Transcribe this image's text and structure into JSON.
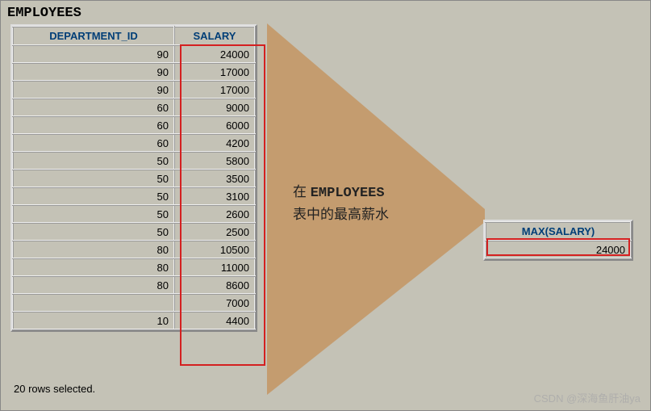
{
  "title": "EMPLOYEES",
  "columns": {
    "dept": "DEPARTMENT_ID",
    "salary": "SALARY"
  },
  "rows": [
    {
      "dept": "90",
      "salary": "24000"
    },
    {
      "dept": "90",
      "salary": "17000"
    },
    {
      "dept": "90",
      "salary": "17000"
    },
    {
      "dept": "60",
      "salary": "9000"
    },
    {
      "dept": "60",
      "salary": "6000"
    },
    {
      "dept": "60",
      "salary": "4200"
    },
    {
      "dept": "50",
      "salary": "5800"
    },
    {
      "dept": "50",
      "salary": "3500"
    },
    {
      "dept": "50",
      "salary": "3100"
    },
    {
      "dept": "50",
      "salary": "2600"
    },
    {
      "dept": "50",
      "salary": "2500"
    },
    {
      "dept": "80",
      "salary": "10500"
    },
    {
      "dept": "80",
      "salary": "11000"
    },
    {
      "dept": "80",
      "salary": "8600"
    },
    {
      "dept": "",
      "salary": "7000"
    },
    {
      "dept": "10",
      "salary": "4400"
    }
  ],
  "caption": {
    "line1a": "在 ",
    "line1b": "EMPLOYEES",
    "line2": "表中的最高薪水"
  },
  "result": {
    "header": "MAX(SALARY)",
    "value": "24000"
  },
  "footer": "20 rows selected.",
  "watermark": "CSDN @深海鱼肝油ya"
}
